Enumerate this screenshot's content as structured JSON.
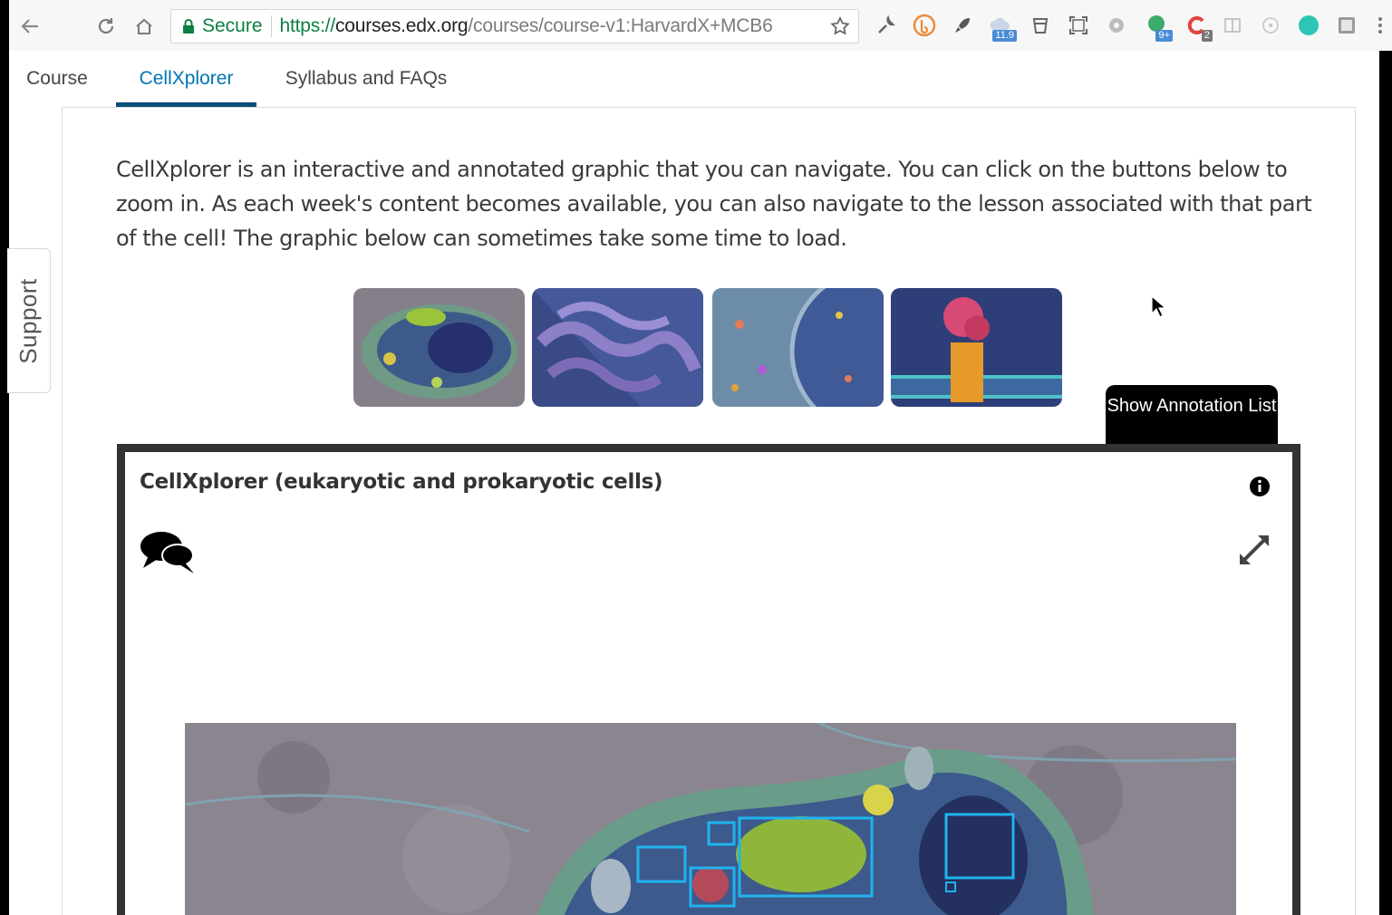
{
  "browser": {
    "secure_label": "Secure",
    "url_protocol": "https://",
    "url_host": "courses.edx.org",
    "url_path": "/courses/course-v1:HarvardX+MCB6",
    "extension_badges": [
      "11.9",
      "9+",
      "2"
    ]
  },
  "tabs": [
    {
      "label": "Course"
    },
    {
      "label": "CellXplorer"
    },
    {
      "label": "Syllabus and FAQs"
    }
  ],
  "support": {
    "label": "Support"
  },
  "intro": {
    "text": "CellXplorer is an interactive and annotated graphic that you can navigate. You can click on the buttons below to zoom in. As each week's content becomes available, you can also navigate to the lesson associated with that part of the cell! The graphic below can sometimes take some time to load."
  },
  "annotation_button": {
    "label": "Show Annotation List"
  },
  "viewer": {
    "title": "CellXplorer (eukaryotic and prokaryotic cells)"
  },
  "colors": {
    "accent": "#0075b4",
    "tab_underline": "#0b4f79",
    "secure_green": "#0b8043",
    "annotation_box": "#1fb4ef"
  }
}
